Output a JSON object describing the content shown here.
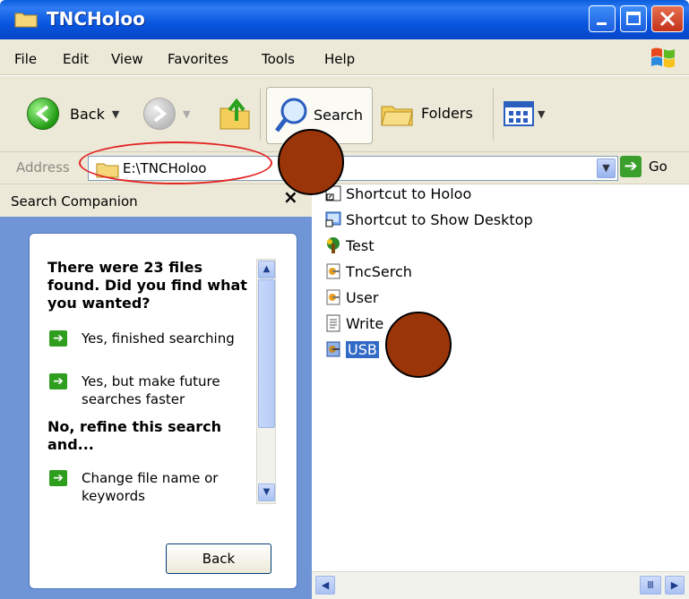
{
  "window": {
    "title": "TNCHoloo"
  },
  "menu": [
    "File",
    "Edit",
    "View",
    "Favorites",
    "Tools",
    "Help"
  ],
  "toolbar": {
    "back": "Back",
    "search": "Search",
    "folders": "Folders"
  },
  "address": {
    "label": "Address",
    "value": "E:\\TNCHoloo",
    "go": "Go"
  },
  "search_companion": {
    "title": "Search Companion",
    "result_text": "There were 23 files found. Did you find what you wanted?",
    "options": [
      "Yes, finished searching",
      "Yes, but make future searches faster"
    ],
    "refine_heading": "No, refine this search and...",
    "refine_options": [
      "Change file name or keywords"
    ],
    "back_button": "Back"
  },
  "files": [
    {
      "name": "Shortcut to Holoo",
      "icon": "shortcut-icon"
    },
    {
      "name": "Shortcut to Show Desktop",
      "icon": "desktop-shortcut-icon"
    },
    {
      "name": "Test",
      "icon": "app-icon"
    },
    {
      "name": "TncSerch",
      "icon": "config-file-icon"
    },
    {
      "name": "User",
      "icon": "config-file-icon"
    },
    {
      "name": "Write",
      "icon": "text-file-icon"
    },
    {
      "name": "USB",
      "icon": "config-file-icon",
      "selected": true
    }
  ],
  "colors": {
    "titlebar": "#0a5ddd",
    "panel": "#6f95d6",
    "annotation_red": "#e32222",
    "marker": "#9a3409"
  }
}
